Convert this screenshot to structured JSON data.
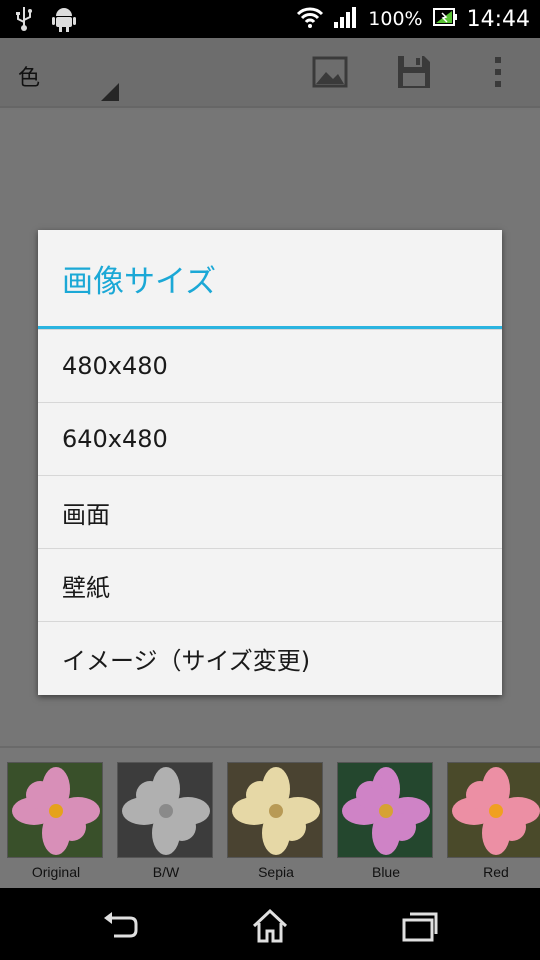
{
  "status_bar": {
    "battery_text": "100%",
    "time": "14:44",
    "icons": [
      "usb-icon",
      "android-debug-icon",
      "wifi-icon",
      "signal-icon",
      "battery-charging-icon"
    ]
  },
  "action_bar": {
    "spinner_label": "色",
    "icons": [
      "image-icon",
      "save-icon",
      "overflow-menu-icon"
    ]
  },
  "dialog": {
    "title": "画像サイズ",
    "items": [
      "480x480",
      "640x480",
      "画面",
      "壁紙",
      "イメージ（サイズ変更)"
    ]
  },
  "filters": [
    {
      "label": "Original",
      "tint": "#d88fb8"
    },
    {
      "label": "B/W",
      "tint": "#b0b0b0"
    },
    {
      "label": "Sepia",
      "tint": "#e6d8a6"
    },
    {
      "label": "Blue",
      "tint": "#cf83c6"
    },
    {
      "label": "Red",
      "tint": "#ec8fa4"
    }
  ],
  "nav_bar": {
    "icons": [
      "back-icon",
      "home-icon",
      "recent-apps-icon"
    ]
  }
}
